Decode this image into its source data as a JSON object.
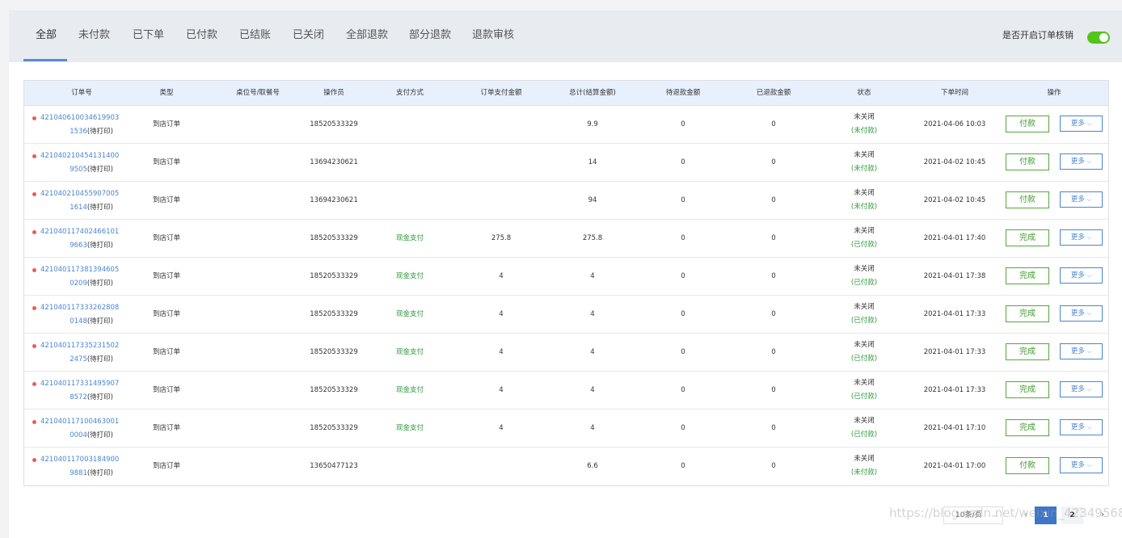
{
  "tabs": [
    {
      "label": "全部",
      "active": true
    },
    {
      "label": "未付款"
    },
    {
      "label": "已下单"
    },
    {
      "label": "已付款"
    },
    {
      "label": "已结账"
    },
    {
      "label": "已关闭"
    },
    {
      "label": "全部退款"
    },
    {
      "label": "部分退款"
    },
    {
      "label": "退款审核"
    }
  ],
  "toggle": {
    "label": "是否开启订单核销",
    "on": true,
    "color": "#52c41a"
  },
  "table": {
    "columns": [
      "订单号",
      "类型",
      "桌位号/取餐号",
      "操作员",
      "支付方式",
      "订单支付金额",
      "总计(结算金额)",
      "待退款金额",
      "已退款金额",
      "状态",
      "下单时间",
      "操作"
    ],
    "rows": [
      {
        "order_a": "421040610034619903",
        "order_b": "1536",
        "print": "(待打印)",
        "type": "到店订单",
        "table_no": "",
        "operator": "18520533329",
        "pay_method": "",
        "pay_amount": "",
        "total": "9.9",
        "pending_refund": "0",
        "refunded": "0",
        "status": "未关闭",
        "pay_status": "(未付款)",
        "time": "2021-04-06 10:03",
        "action": "付款",
        "more": "更多"
      },
      {
        "order_a": "421040210454131400",
        "order_b": "9505",
        "print": "(待打印)",
        "type": "到店订单",
        "table_no": "",
        "operator": "13694230621",
        "pay_method": "",
        "pay_amount": "",
        "total": "14",
        "pending_refund": "0",
        "refunded": "0",
        "status": "未关闭",
        "pay_status": "(未付款)",
        "time": "2021-04-02 10:45",
        "action": "付款",
        "more": "更多"
      },
      {
        "order_a": "421040210455907005",
        "order_b": "1614",
        "print": "(待打印)",
        "type": "到店订单",
        "table_no": "",
        "operator": "13694230621",
        "pay_method": "",
        "pay_amount": "",
        "total": "94",
        "pending_refund": "0",
        "refunded": "0",
        "status": "未关闭",
        "pay_status": "(未付款)",
        "time": "2021-04-02 10:45",
        "action": "付款",
        "more": "更多"
      },
      {
        "order_a": "421040117402466101",
        "order_b": "9663",
        "print": "(待打印)",
        "type": "到店订单",
        "table_no": "",
        "operator": "18520533329",
        "pay_method": "现金支付",
        "pay_amount": "275.8",
        "total": "275.8",
        "pending_refund": "0",
        "refunded": "0",
        "status": "未关闭",
        "pay_status": "(已付款)",
        "time": "2021-04-01 17:40",
        "action": "完成",
        "more": "更多"
      },
      {
        "order_a": "421040117381394605",
        "order_b": "0209",
        "print": "(待打印)",
        "type": "到店订单",
        "table_no": "",
        "operator": "18520533329",
        "pay_method": "现金支付",
        "pay_amount": "4",
        "total": "4",
        "pending_refund": "0",
        "refunded": "0",
        "status": "未关闭",
        "pay_status": "(已付款)",
        "time": "2021-04-01 17:38",
        "action": "完成",
        "more": "更多"
      },
      {
        "order_a": "421040117333262808",
        "order_b": "0148",
        "print": "(待打印)",
        "type": "到店订单",
        "table_no": "",
        "operator": "18520533329",
        "pay_method": "现金支付",
        "pay_amount": "4",
        "total": "4",
        "pending_refund": "0",
        "refunded": "0",
        "status": "未关闭",
        "pay_status": "(已付款)",
        "time": "2021-04-01 17:33",
        "action": "完成",
        "more": "更多"
      },
      {
        "order_a": "421040117335231502",
        "order_b": "2475",
        "print": "(待打印)",
        "type": "到店订单",
        "table_no": "",
        "operator": "18520533329",
        "pay_method": "现金支付",
        "pay_amount": "4",
        "total": "4",
        "pending_refund": "0",
        "refunded": "0",
        "status": "未关闭",
        "pay_status": "(已付款)",
        "time": "2021-04-01 17:33",
        "action": "完成",
        "more": "更多"
      },
      {
        "order_a": "421040117331495907",
        "order_b": "8572",
        "print": "(待打印)",
        "type": "到店订单",
        "table_no": "",
        "operator": "18520533329",
        "pay_method": "现金支付",
        "pay_amount": "4",
        "total": "4",
        "pending_refund": "0",
        "refunded": "0",
        "status": "未关闭",
        "pay_status": "(已付款)",
        "time": "2021-04-01 17:33",
        "action": "完成",
        "more": "更多"
      },
      {
        "order_a": "421040117100463001",
        "order_b": "0004",
        "print": "(待打印)",
        "type": "到店订单",
        "table_no": "",
        "operator": "18520533329",
        "pay_method": "现金支付",
        "pay_amount": "4",
        "total": "4",
        "pending_refund": "0",
        "refunded": "0",
        "status": "未关闭",
        "pay_status": "(已付款)",
        "time": "2021-04-01 17:10",
        "action": "完成",
        "more": "更多"
      },
      {
        "order_a": "421040117003184900",
        "order_b": "9881",
        "print": "(待打印)",
        "type": "到店订单",
        "table_no": "",
        "operator": "13650477123",
        "pay_method": "",
        "pay_amount": "",
        "total": "6.6",
        "pending_refund": "0",
        "refunded": "0",
        "status": "未关闭",
        "pay_status": "(未付款)",
        "time": "2021-04-01 17:00",
        "action": "付款",
        "more": "更多"
      }
    ]
  },
  "pagination": {
    "page_size": "10条/页",
    "pages": [
      "1",
      "2"
    ],
    "current": "1",
    "prev": "‹",
    "next": "›"
  },
  "watermark": "https://blog.csdn.net/weixin_42349568",
  "colors": {
    "accent": "#3d75c9",
    "success": "#52a83a",
    "danger_dot": "#e85c5c",
    "link": "#4a86cf"
  }
}
